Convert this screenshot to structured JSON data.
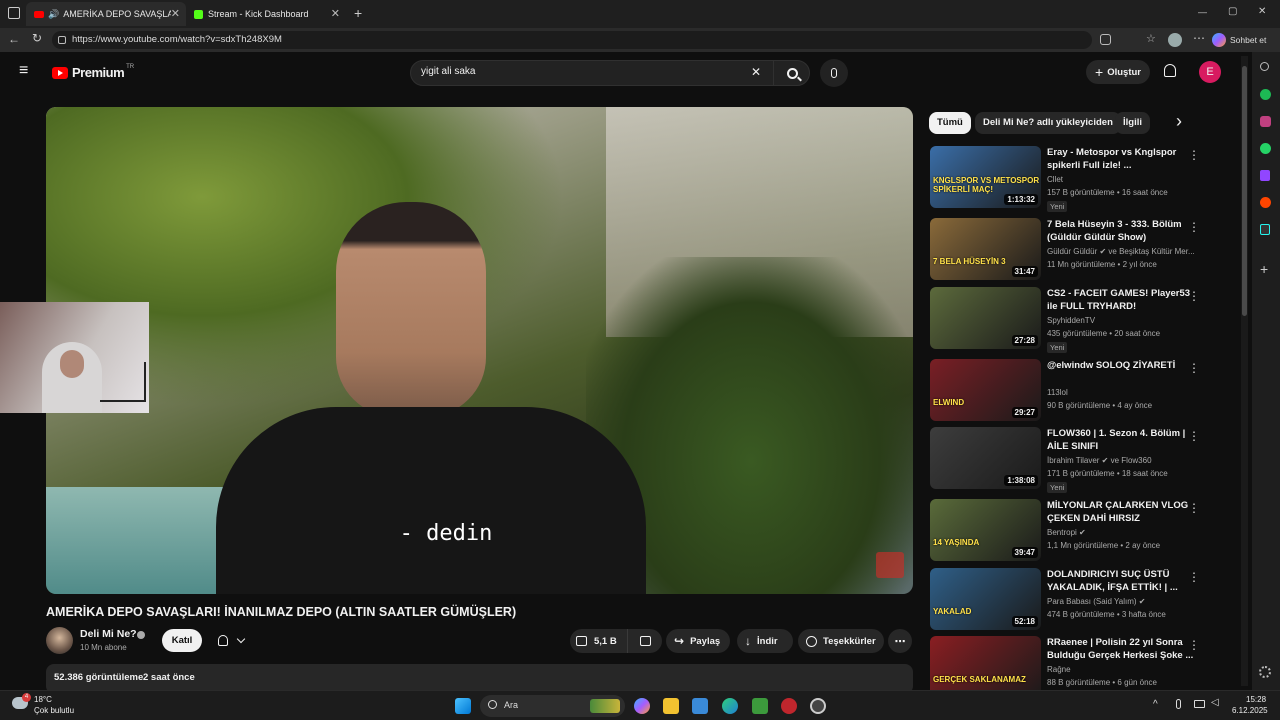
{
  "tabs": [
    {
      "label": "AMERİKA DEPO SAVAŞLARI | İ..."
    },
    {
      "label": "Stream - Kick Dashboard"
    }
  ],
  "browser": {
    "url": "https://www.youtube.com/watch?v=sdxTh248X9M",
    "copilot_label": "Sohbet et"
  },
  "youtube": {
    "logo": "Premium",
    "logo_region": "TR",
    "search_value": "yigit ali saka",
    "create_label": "Oluştur",
    "avatar_letter": "E"
  },
  "video": {
    "subtitle": "- dedin",
    "title": "AMERİKA DEPO SAVAŞLARI! İNANILMAZ DEPO (ALTIN SAATLER GÜMÜŞLER)",
    "channel": "Deli Mi Ne?",
    "subscribers": "10 Mn abone",
    "join_label": "Katıl",
    "likes": "5,1 B",
    "share_label": "Paylaş",
    "download_label": "İndir",
    "thanks_label": "Teşekkürler",
    "views": "52.386 görüntüleme",
    "time_ago": "2 saat önce"
  },
  "chips": [
    "Tümü",
    "Deli Mi Ne? adlı yükleyiciden",
    "İlgili"
  ],
  "recommendations": [
    {
      "title": "Eray - Metospor vs Knglspor spikerli Full izle! ...",
      "channel": "Cllet",
      "meta": "157 B görüntüleme • 16 saat önce",
      "badge": "Yeni",
      "duration": "1:13:32",
      "thumb_text": "KNGLSPOR VS METOSPOR SPİKERLİ MAÇ!",
      "color": "#3a6ea8"
    },
    {
      "title": "7 Bela Hüseyin 3 - 333. Bölüm (Güldür Güldür Show)",
      "channel": "Güldür Güldür ✔ ve Beşiktaş Kültür Mer...",
      "meta": "11 Mn görüntüleme • 2 yıl önce",
      "badge": "",
      "duration": "31:47",
      "thumb_text": "7 BELA HÜSEYİN 3",
      "color": "#8a6a3a"
    },
    {
      "title": "CS2 - FACEIT GAMES! Player53 ile FULL TRYHARD!",
      "channel": "SpyhiddenTV",
      "meta": "435 görüntüleme • 20 saat önce",
      "badge": "Yeni",
      "duration": "27:28",
      "thumb_text": "",
      "color": "#5c6a3c"
    },
    {
      "title": "@elwindw SOLOQ ZİYARETİ",
      "channel": "113lol",
      "meta": "90 B görüntüleme • 4 ay önce",
      "badge": "",
      "duration": "29:27",
      "thumb_text": "ELWIND",
      "color": "#7a1f25"
    },
    {
      "title": "FLOW360 | 1. Sezon 4. Bölüm | AİLE SINIFI",
      "channel": "İbrahim Tilaver ✔ ve Flow360",
      "meta": "171 B görüntüleme • 18 saat önce",
      "badge": "Yeni",
      "duration": "1:38:08",
      "thumb_text": "",
      "color": "#3d3d3d"
    },
    {
      "title": "MİLYONLAR ÇALARKEN VLOG ÇEKEN DAHİ HIRSIZ",
      "channel": "Bentropi ✔",
      "meta": "1,1 Mn görüntüleme • 2 ay önce",
      "badge": "",
      "duration": "39:47",
      "thumb_text": "14 YAŞINDA",
      "color": "#5a6b3a"
    },
    {
      "title": "DOLANDIRICIYI SUÇ ÜSTÜ YAKALADIK, İFŞA ETTİK! | ...",
      "channel": "Para Babası (Said Yalım) ✔",
      "meta": "474 B görüntüleme • 3 hafta önce",
      "badge": "",
      "duration": "52:18",
      "thumb_text": "YAKALAD",
      "color": "#2f5f88"
    },
    {
      "title": "RRaenee | Polisin 22 yıl Sonra Bulduğu Gerçek Herkesi Şoke ...",
      "channel": "Rağne",
      "meta": "88 B görüntüleme • 6 gün önce",
      "badge": "",
      "duration": "",
      "thumb_text": "GERÇEK SAKLANAMAZ",
      "color": "#8a1e22"
    }
  ],
  "taskbar": {
    "temp": "18°C",
    "weather": "Çok bulutlu",
    "search_label": "Ara",
    "time": "15:28",
    "date": "6.12.2025",
    "notif_count": "4"
  },
  "icons": {
    "tab_close": "✕",
    "new_tab": "+",
    "back": "←",
    "refresh": "↻",
    "menu": "≡",
    "search": "⌕",
    "mic": "🎙",
    "bell": "🔔",
    "plus": "+",
    "chev_right": "›",
    "kebab": "⋮",
    "more": "⋯",
    "caret": "⌄",
    "bell_small": "🔔",
    "like": "👍",
    "dislike": "👎",
    "share": "↪",
    "download": "↓",
    "thanks": "$",
    "win_min": "—",
    "win_max": "▢",
    "win_close": "✕"
  }
}
